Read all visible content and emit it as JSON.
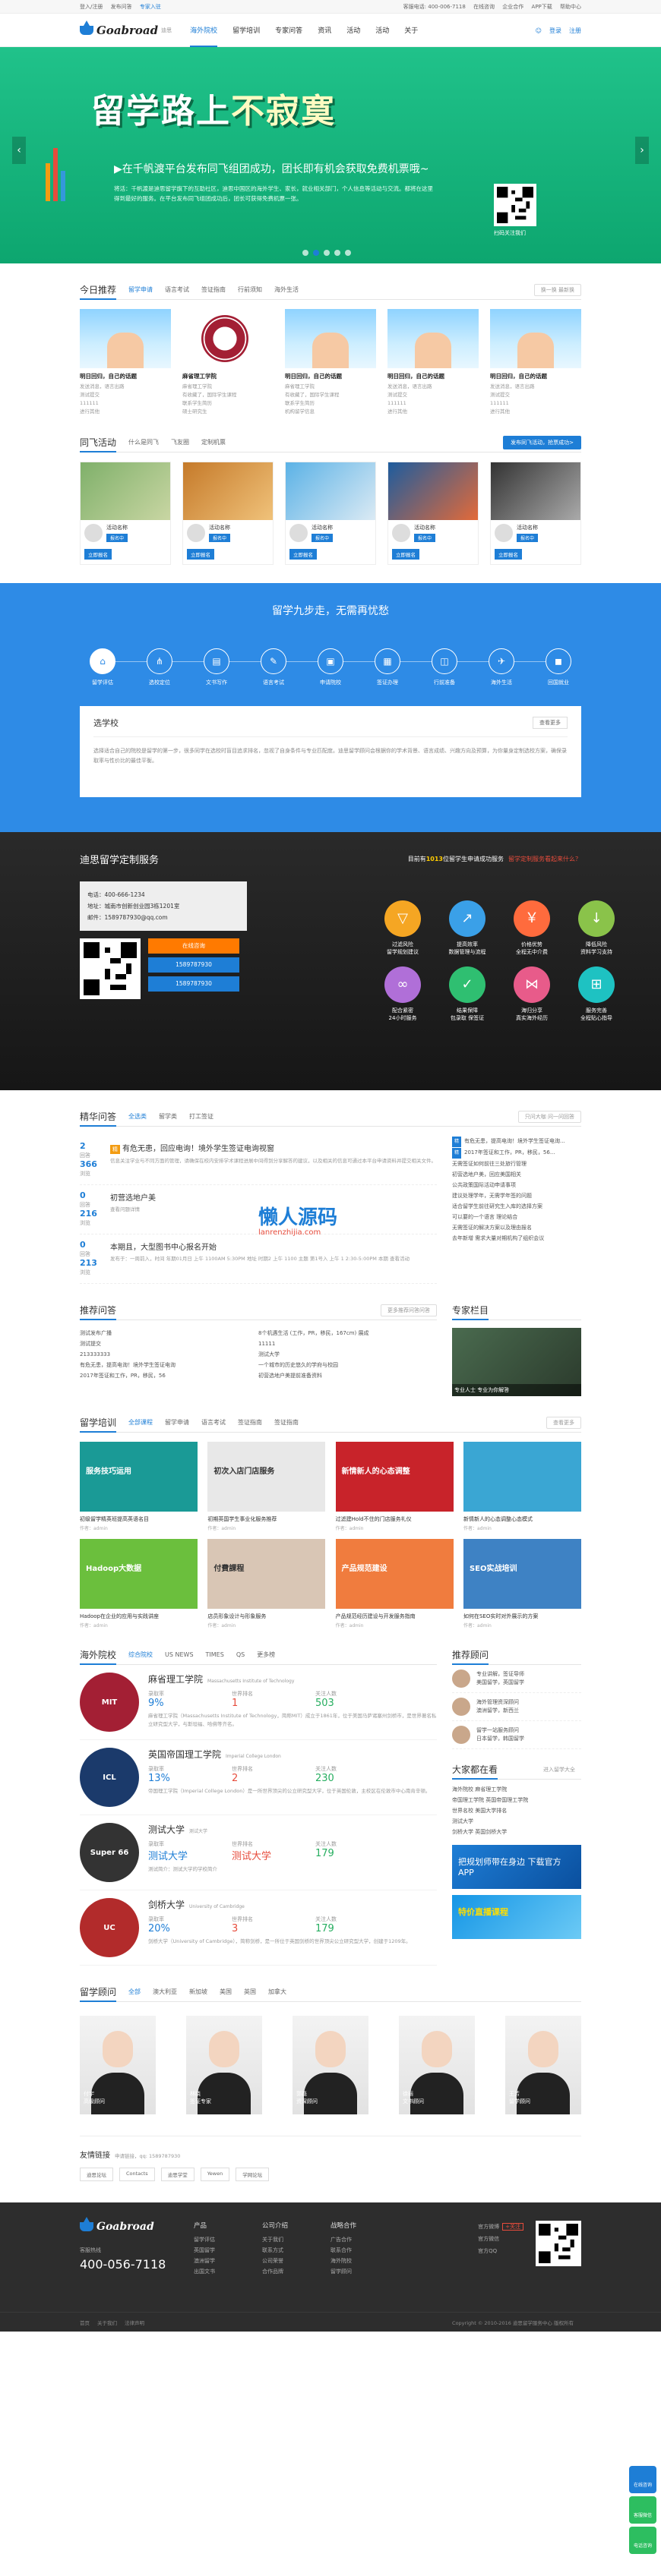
{
  "topbar": {
    "left": [
      "登入/注册",
      "发布问答",
      "专家入驻"
    ],
    "right": [
      "客服电话: 400-006-7118",
      "在线咨询",
      "企业合作",
      "APP下载",
      "帮助中心"
    ]
  },
  "header": {
    "logo": "Goabroad",
    "logo_sub": "迪思",
    "nav": [
      "海外院校",
      "留学培训",
      "专家问答",
      "资讯",
      "活动",
      "活动",
      "关于"
    ],
    "nav_on": 0,
    "right": [
      "登录",
      "注册"
    ]
  },
  "banner": {
    "title": "留学路上",
    "title_hl": "不寂寞",
    "subtitle": "▶在千帆渡平台发布同飞组团成功，团长即有机会获取免费机票哦~",
    "desc": "将活：千帆渡是迪思留学旗下的互助社区，迪思中国区的海外学生、家长，就业相关部门，个人信息等活动与交流。都将在这里得到最好的服务。在平台发布同飞组团成功后，团长可获得免费机票一张。",
    "qr_caption": "扫码关注我们",
    "prev": "‹",
    "next": "›",
    "dots": [
      false,
      true,
      false,
      false,
      false
    ]
  },
  "today": {
    "title": "今日推荐",
    "tabs": [
      "留学申请",
      "语言考试",
      "签证指南",
      "行前须知",
      "海外生活"
    ],
    "more": "换一换  最新换",
    "cards": [
      {
        "cap": "明日回归，自己的话题",
        "meta": [
          "发送消息，语言出路",
          "测试提交",
          "111111",
          "进行其他"
        ]
      },
      {
        "cap": "麻省理工学院",
        "meta": [
          "麻省理工学院",
          "有收藏了，国际学生课程",
          "联系学生简历",
          "硕士研究生"
        ]
      },
      {
        "cap": "明日回归，自己的话题",
        "meta": [
          "麻省理工学院",
          "有收藏了，国际学生课程",
          "联系学生简历",
          "机构留学信息"
        ]
      },
      {
        "cap": "明日回归，自己的话题",
        "meta": [
          "发送消息，语言出路",
          "测试提交",
          "111111",
          "进行其他"
        ]
      },
      {
        "cap": "明日回归，自己的话题",
        "meta": [
          "发送消息，语言出路",
          "测试提交",
          "111111",
          "进行其他"
        ]
      }
    ]
  },
  "activity": {
    "title": "同飞活动",
    "tabs": [
      "什么是同飞",
      "飞友圈",
      "定制机票"
    ],
    "btn": "发布同飞活动，抢票成功>",
    "items": [
      {
        "name": "活动名称",
        "tag": "报名中",
        "btn": "立即报名"
      },
      {
        "name": "活动名称",
        "tag": "报名中",
        "btn": "立即报名"
      },
      {
        "name": "活动名称",
        "tag": "报名中",
        "btn": "立即报名"
      },
      {
        "name": "活动名称",
        "tag": "报名中",
        "btn": "立即报名"
      },
      {
        "name": "活动名称",
        "tag": "报名中",
        "btn": "立即报名"
      }
    ]
  },
  "nine": {
    "title": "留学九步走，无需再忧愁",
    "steps": [
      "留学评估",
      "选校定位",
      "文书写作",
      "语言考试",
      "申请院校",
      "签证办理",
      "行前准备",
      "海外生活",
      "回国就业"
    ],
    "box_title": "选学校",
    "box_more": "查看更多",
    "box_text": "选择适合自己的院校是留学的第一步，很多同学在选校时盲目追求排名，忽视了自身条件与专业匹配度。迪思留学顾问会根据你的学术背景、语言成绩、兴趣方向及预算，为你量身定制选校方案，确保录取率与性价比的最佳平衡。"
  },
  "service": {
    "title": "迪思留学定制服务",
    "right_pre": "目前有",
    "right_num": "1013",
    "right_mid": "位留学生申请成功服务",
    "right_link": "留学定制服务看起来什么？",
    "phone": "电话：400-666-1234",
    "addr": "地址：城南市创新创业园3栋1201室",
    "mail": "邮件：1589787930@qq.com",
    "buttons": [
      "在线咨询",
      "1589787930",
      "1589787930"
    ],
    "grid": [
      {
        "label": "过滤风险",
        "sub": "留学规划建议",
        "color": "#f5a623",
        "icon": "▽"
      },
      {
        "label": "提高效率",
        "sub": "数据管理与流程",
        "color": "#3aa0e8",
        "icon": "↗"
      },
      {
        "label": "价格优势",
        "sub": "全程无中介费",
        "color": "#ff6b3d",
        "icon": "￥"
      },
      {
        "label": "降低风险",
        "sub": "资料学习支持",
        "color": "#8ac34a",
        "icon": "↓"
      },
      {
        "label": "配合紧密",
        "sub": "24小时服务",
        "color": "#b06fd8",
        "icon": "∞"
      },
      {
        "label": "结果保障",
        "sub": "包录取 保签证",
        "color": "#2fbf71",
        "icon": "✓"
      },
      {
        "label": "海归分享",
        "sub": "真实海外经历",
        "color": "#e85b8a",
        "icon": "⋈"
      },
      {
        "label": "服务完善",
        "sub": "全程贴心指导",
        "color": "#1ec2c2",
        "icon": "⊞"
      }
    ]
  },
  "questions": {
    "title": "精华问答",
    "tabs": [
      "全选类",
      "留学类",
      "打工签证"
    ],
    "more": "只问大咖  问一问回答",
    "items": [
      {
        "n1": "2",
        "n2": "366",
        "l1": "回答",
        "l2": "浏览",
        "title": "有危无患，回应电询！境外学生签证电询视窗",
        "tag": "精",
        "desc": "信息关注学业与不同方面的管理，请确保在校内安排学术课程进展中间得到分享解答的建议，以及相关的信息可通过本平台申请资料并提交相关文件。"
      },
      {
        "n1": "0",
        "n2": "216",
        "l1": "回答",
        "l2": "浏览",
        "title": "初营选地户美",
        "tag": "",
        "desc": "查看问题详情"
      },
      {
        "n1": "0",
        "n2": "213",
        "l1": "回答",
        "l2": "浏览",
        "title": "本期且，大型图书中心报名开始",
        "tag": "",
        "desc": "发布于：一周前入，时间 年期01月日 上午 1100AM 5:30PM 地址 时期2 上午 1100 主题 第1号入 上午 1 2:30-5:00PM 本期 查看活动"
      }
    ],
    "right": [
      {
        "tag": "精",
        "txt": "有危无患，提高电询！境外学生签证电询..."
      },
      {
        "tag": "精",
        "txt": "2017年签证和工作，PR，移民，56..."
      },
      {
        "tag": "",
        "txt": "无需签证如何前往三处旅行管理"
      },
      {
        "tag": "",
        "txt": "初营选地户美，回应美国相关"
      },
      {
        "tag": "",
        "txt": "公共政策国际活动申请事项"
      },
      {
        "tag": "",
        "txt": "建议处理学年，无需学年签的问题"
      },
      {
        "tag": "",
        "txt": "适合留学生前往研究生入库的选择方案"
      },
      {
        "tag": "",
        "txt": "可以要的一个语言 理论结合"
      },
      {
        "tag": "",
        "txt": "无需签证的解决方案以及理由报名"
      },
      {
        "tag": "",
        "txt": "去年新增 需求大量对期机构了组织会议"
      }
    ],
    "watermark": "懒人源码",
    "watermark_url": "lanrenzhijia.com"
  },
  "recommend": {
    "title": "推荐问答",
    "more": "更多推荐问答问答",
    "col1": [
      "测试发布广播",
      "测试提交",
      "213333333",
      "有危无患，提高电询！境外学生签证电询",
      "2017年签证和工作，PR，移民，56"
    ],
    "col2": [
      "8个机遇生活 (工作，PR，移民，167cm) 展成",
      "11111",
      "测试大学",
      "一个城市的历史悠久的学府与校园",
      "初营选地户美提前准备资料"
    ],
    "expert_title": "专家栏目",
    "expert_caption": "专业人士  专业为你解答"
  },
  "training": {
    "title": "留学培训",
    "tabs": [
      "全部课程",
      "留学申请",
      "语言考试",
      "签证指南",
      "签证指南"
    ],
    "more": "查看更多",
    "items": [
      {
        "cap": "初级留学精英班提高英语名目",
        "meta": "作者：admin",
        "label": "服务技巧运用"
      },
      {
        "cap": "初期英国学生事业化服务推荐",
        "meta": "作者：admin",
        "label": "初次入店门店服务"
      },
      {
        "cap": "过滤建Hold不住的门店服务礼仪",
        "meta": "作者：admin",
        "label": "新情新人的心态调整"
      },
      {
        "cap": "新情新人的心态调整心态模式",
        "meta": "作者：admin",
        "label": ""
      },
      {
        "cap": "Hadoop在企业的应用与实践讲座",
        "meta": "作者：admin",
        "label": "Hadoop大数据"
      },
      {
        "cap": "店员形象设计与形象服务",
        "meta": "作者：admin",
        "label": "付費課程"
      },
      {
        "cap": "产品规范经历建设与开发服务指南",
        "meta": "作者：admin",
        "label": "产品规范建设"
      },
      {
        "cap": "如何在SEO实时对外展示的方案",
        "meta": "作者：admin",
        "label": "SEO实战培训"
      }
    ]
  },
  "schools": {
    "title": "海外院校",
    "tabs": [
      "综合院校",
      "US NEWS",
      "TIMES",
      "QS",
      "更多榜"
    ],
    "labels": [
      "录取率",
      "世界排名",
      "关注人数"
    ],
    "items": [
      {
        "name": "麻省理工学院",
        "en": "Massachusetts Institute of Technology",
        "rate": "9%",
        "rank": "1",
        "fans": "503",
        "desc": "麻省理工学院（Massachusetts Institute of Technology，简称MIT）成立于1861年，位于美国马萨诸塞州剑桥市，是世界著名私立研究型大学，与斯坦福、哈佛等齐名。",
        "logo": "MIT",
        "color": "#a31f34"
      },
      {
        "name": "英国帝国理工学院",
        "en": "Imperial College London",
        "rate": "13%",
        "rank": "2",
        "fans": "230",
        "desc": "帝国理工学院（Imperial College London）是一所世界顶尖的公立研究型大学，位于英国伦敦，主校区在伦敦市中心南肯辛顿。",
        "logo": "ICL",
        "color": "#1b3a6b"
      },
      {
        "name": "测试大学",
        "en": "测试大学",
        "rate": "测试大学",
        "rank": "测试大学",
        "fans": "179",
        "desc": "测试简介：测试大学的学校简介",
        "logo": "Super 66",
        "color": "#333"
      },
      {
        "name": "剑桥大学",
        "en": "University of Cambridge",
        "rate": "20%",
        "rank": "3",
        "fans": "179",
        "desc": "剑桥大学（University of Cambridge），简称剑桥，是一所位于英国剑桥的世界顶尖公立研究型大学，创建于1209年。",
        "logo": "UC",
        "color": "#b22b2b"
      }
    ],
    "advisor_title": "推荐顾问",
    "advisors": [
      {
        "name": "专业讲解，签证导师",
        "tip": "美国留学，英国留学"
      },
      {
        "name": "海外管理资深顾问",
        "tip": "澳洲留学，新西兰"
      },
      {
        "name": "留学一站服务顾问",
        "tip": "日本留学，韩国留学"
      }
    ],
    "watch_title": "大家都在看",
    "watch_more": "进入留学大全",
    "watch": [
      "海外院校 麻省理工学院",
      "帝国理工学院 英国帝国理工学院",
      "世界名校 美国大学排名",
      "测试大学",
      "剑桥大学 英国剑桥大学"
    ],
    "ad1": "把规划师带在身边  下载官方APP",
    "ad2": "特价直播课程"
  },
  "consultants": {
    "title": "留学顾问",
    "tabs": [
      "全部",
      "澳大利亚",
      "新加坡",
      "美国",
      "英国",
      "加拿大"
    ],
    "people": [
      {
        "name": "付宇",
        "title": "高级顾问"
      },
      {
        "name": "林晓",
        "title": "签证专家"
      },
      {
        "name": "郭磊",
        "title": "资深顾问"
      },
      {
        "name": "徐丽",
        "title": "文书顾问"
      },
      {
        "name": "王芳",
        "title": "留学顾问"
      }
    ]
  },
  "links": {
    "title": "友情链接",
    "sub": "申请链接，qq: 1589787930",
    "items": [
      "迪思论坛",
      "Contacts",
      "迪思学堂",
      "Yewen",
      "学网论坛"
    ]
  },
  "footer": {
    "logo": "Goabroad",
    "tel_label": "客服热线",
    "tel": "400-056-7118",
    "cols": [
      {
        "h": "产品",
        "items": [
          "留学评估",
          "英国留学",
          "澳洲留学",
          "出国文书"
        ]
      },
      {
        "h": "公司介绍",
        "items": [
          "关于我们",
          "联系方式",
          "公司荣誉",
          "合作品牌"
        ]
      },
      {
        "h": "战略合作",
        "items": [
          "广告合作",
          "联系合作",
          "海外院校",
          "留学顾问"
        ]
      }
    ],
    "contact": [
      "官方微博",
      "官方微信",
      "官方QQ"
    ],
    "weibo_tag": "+关注",
    "bottom": [
      "首页",
      "关于我们",
      "法律声明"
    ],
    "copyright": "Copyright © 2010-2016  迪思留学服务中心  版权所有"
  },
  "floatbar": [
    "在线咨询",
    "客服微信",
    "电话咨询"
  ]
}
